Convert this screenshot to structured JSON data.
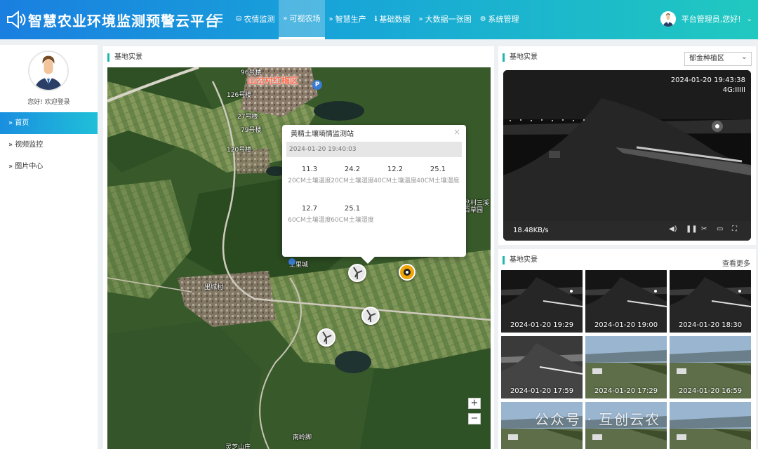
{
  "header": {
    "title": "智慧农业环境监测预警云平台",
    "nav": [
      {
        "label": "农情监测",
        "icon": "database-icon",
        "glyph": "⛁"
      },
      {
        "label": "可视农场",
        "icon": "chevron-right-icon",
        "glyph": "»"
      },
      {
        "label": "智慧生产",
        "icon": "chevron-right-icon",
        "glyph": "»"
      },
      {
        "label": "基础数据",
        "icon": "info-icon",
        "glyph": "ℹ"
      },
      {
        "label": "大数据一张图",
        "icon": "chevron-right-icon",
        "glyph": "»"
      },
      {
        "label": "系统管理",
        "icon": "gear-icon",
        "glyph": "⚙"
      }
    ],
    "active_nav": 1,
    "user_greeting": "平台管理员,您好!"
  },
  "sidebar": {
    "welcome": "您好! 欢迎登录",
    "items": [
      {
        "label": "» 首页"
      },
      {
        "label": "» 视频监控"
      },
      {
        "label": "» 图片中心"
      }
    ],
    "active_item": 0
  },
  "map_panel": {
    "title": "基地实景",
    "labels": {
      "village_red": "山岔村红梅区",
      "top": "96号楼",
      "b126": "126号楼",
      "b27": "27号楼",
      "b79": "79号楼",
      "b120": "120号楼",
      "right1": "岔村三溪",
      "right2": "百草园",
      "shangli": "上里城",
      "lichengcun": "里城村",
      "lingzhi": "灵芝山庄",
      "nanling": "南岭脚"
    },
    "zoom_in": "+",
    "zoom_out": "−",
    "popup": {
      "title": "黄精土壤墒情监测站",
      "close": "×",
      "time": "2024-01-20 19:40:03",
      "readings": [
        {
          "value": "11.3",
          "label": "20CM土壤温度"
        },
        {
          "value": "24.2",
          "label": "20CM土壤湿度"
        },
        {
          "value": "12.2",
          "label": "40CM土壤温度"
        },
        {
          "value": "25.1",
          "label": "40CM土壤湿度"
        },
        {
          "value": "12.7",
          "label": "60CM土壤温度"
        },
        {
          "value": "25.1",
          "label": "60CM土壤湿度"
        }
      ]
    }
  },
  "video_panel": {
    "title": "基地实景",
    "select_value": "郁金种植区",
    "timestamp": "2024-01-20 19:43:38",
    "signal": "4G:IIIII",
    "speed": "18.48KB/s"
  },
  "gallery_panel": {
    "title": "基地实景",
    "more": "查看更多",
    "thumbs": [
      {
        "label": "2024-01-20 19:29",
        "kind": "night"
      },
      {
        "label": "2024-01-20 19:00",
        "kind": "night"
      },
      {
        "label": "2024-01-20 18:30",
        "kind": "night"
      },
      {
        "label": "2024-01-20 17:59",
        "kind": "dusk"
      },
      {
        "label": "2024-01-20 17:29",
        "kind": "day"
      },
      {
        "label": "2024-01-20 16:59",
        "kind": "day"
      },
      {
        "label": "",
        "kind": "day"
      },
      {
        "label": "",
        "kind": "day"
      },
      {
        "label": "",
        "kind": "day"
      }
    ]
  },
  "watermark": "公众号 · 互创云农",
  "colors": {
    "header_start": "#1a7fe0",
    "header_end": "#20c9c0",
    "accent": "#1fb8b0",
    "marker_cam": "#f0a50a"
  }
}
